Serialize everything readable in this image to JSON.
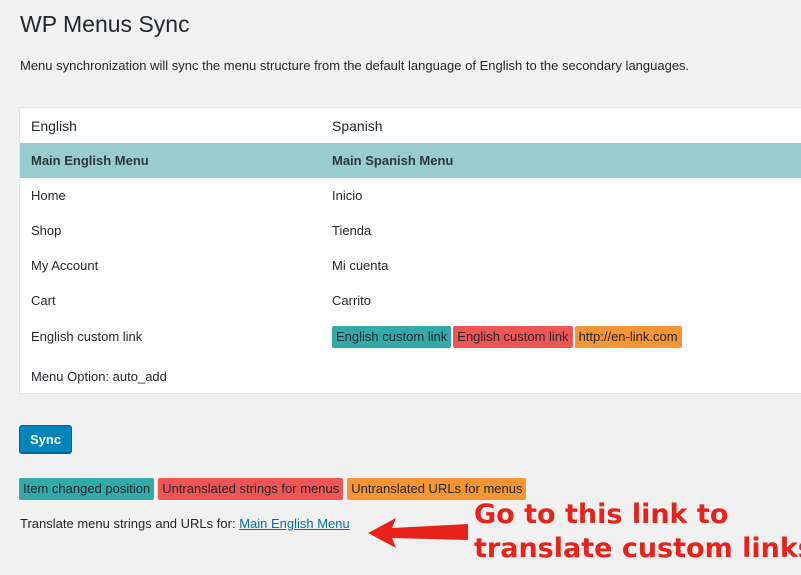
{
  "page": {
    "title": "WP Menus Sync",
    "description": "Menu synchronization will sync the menu structure from the default language of English to the secondary languages."
  },
  "table": {
    "headers": {
      "english": "English",
      "spanish": "Spanish"
    },
    "menu_names": {
      "english": "Main English Menu",
      "spanish": "Main Spanish Menu"
    },
    "rows": [
      {
        "english": "Home",
        "spanish": "Inicio"
      },
      {
        "english": "Shop",
        "spanish": "Tienda"
      },
      {
        "english": "My Account",
        "spanish": "Mi cuenta"
      },
      {
        "english": "Cart",
        "spanish": "Carrito"
      }
    ],
    "custom_link_row": {
      "english": "English custom link",
      "tags": [
        {
          "label": "English custom link",
          "color": "#33aaaa"
        },
        {
          "label": "English custom link",
          "color": "#f05555"
        },
        {
          "label": "http://en-link.com",
          "color": "#f59533"
        }
      ]
    },
    "menu_option": "Menu Option: auto_add"
  },
  "sync_button": {
    "label": "Sync"
  },
  "legend": [
    {
      "label": "Item changed position",
      "color": "#33aaaa"
    },
    {
      "label": "Untranslated strings for menus",
      "color": "#f05555"
    },
    {
      "label": "Untranslated URLs for menus",
      "color": "#f59533"
    }
  ],
  "translate": {
    "prefix": "Translate menu strings and URLs for:",
    "link_label": "Main English Menu"
  },
  "annotation": {
    "line1": "Go to this link to",
    "line2": "translate custom links",
    "color": "#e8221a"
  },
  "colors": {
    "menu_header_bg": "#99cccc",
    "button_bg": "#0085ba",
    "link": "#0073aa"
  }
}
